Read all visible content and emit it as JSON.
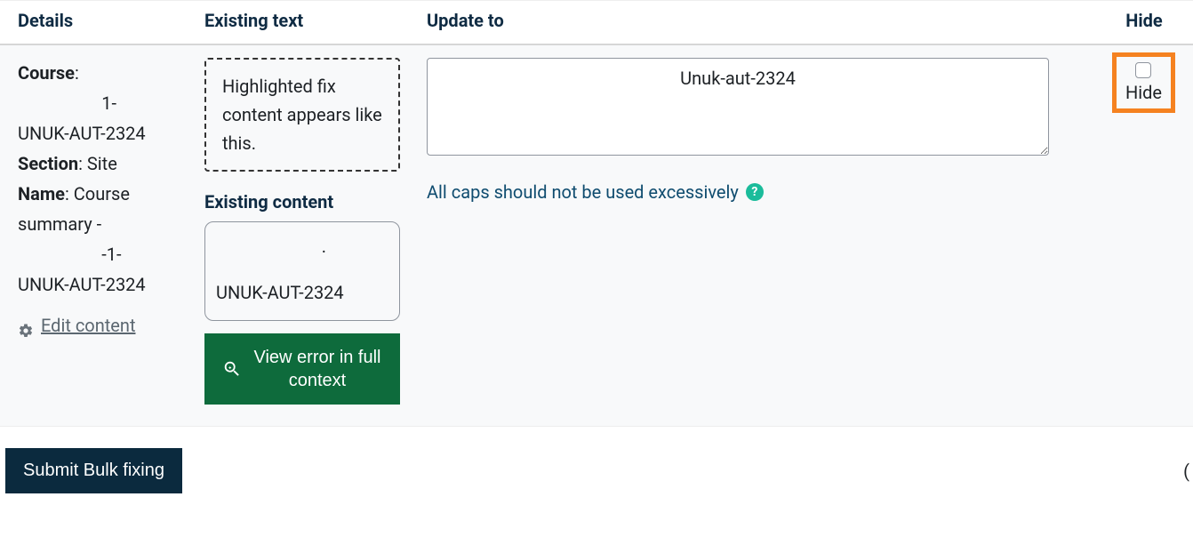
{
  "headers": {
    "details": "Details",
    "existing": "Existing text",
    "update": "Update to",
    "hide": "Hide"
  },
  "details": {
    "course_label": "Course",
    "course_value1": "1-",
    "course_value2": "UNUK-AUT-2324",
    "section_label": "Section",
    "section_value": "Site",
    "name_label": "Name",
    "name_value1": "Course summary -",
    "name_value2": "-1-",
    "name_value3": "UNUK-AUT-2324",
    "edit_link": "Edit content"
  },
  "existing": {
    "highlighted_msg": "Highlighted fix content appears like this.",
    "existing_label": "Existing content",
    "content_line1": ".",
    "content_line2": "UNUK-AUT-2324",
    "view_btn": "View error in full context"
  },
  "update": {
    "textarea_value": "Unuk-aut-2324",
    "caps_msg": "All caps should not be used excessively"
  },
  "hide": {
    "label": "Hide"
  },
  "footer": {
    "submit": "Submit Bulk fixing",
    "right_char": "("
  }
}
